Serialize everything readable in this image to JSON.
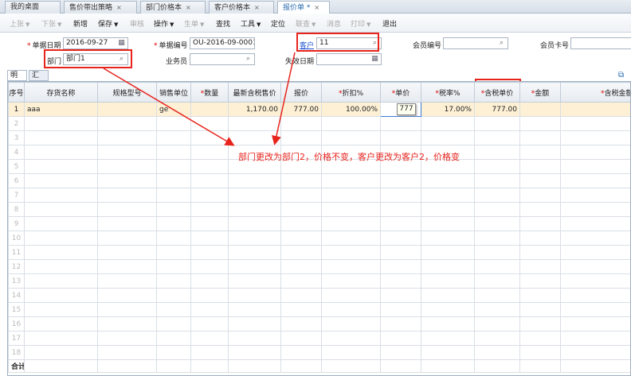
{
  "tabs": [
    {
      "label": "我的桌面",
      "closable": false
    },
    {
      "label": "售价带出策略",
      "closable": true
    },
    {
      "label": "部门价格本",
      "closable": true
    },
    {
      "label": "客户价格本",
      "closable": true
    },
    {
      "label": "报价单 *",
      "closable": true,
      "active": true
    }
  ],
  "close_glyph": "×",
  "toolbar": {
    "prev": "上张",
    "next": "下张",
    "add": "新增",
    "save": "保存",
    "audit": "审核",
    "operate": "操作",
    "generate": "生单",
    "find": "查找",
    "tools": "工具",
    "locate": "定位",
    "join": "联查",
    "message": "消息",
    "print": "打印",
    "exit": "退出"
  },
  "form": {
    "date_label": "单据日期",
    "date_value": "2016-09-27",
    "code_label": "单据编号",
    "code_value": "OU-2016-09-0001",
    "customer_label": "客户",
    "customer_value": "11",
    "member_code_label": "会员编号",
    "member_code_value": "",
    "member_card_label": "会员卡号",
    "member_card_value": "",
    "dept_label": "部门",
    "dept_value": "部门1",
    "salesman_label": "业务员",
    "salesman_value": "",
    "expiry_label": "失效日期",
    "expiry_value": ""
  },
  "subtabs": [
    "明细",
    "汇总"
  ],
  "grid": {
    "headers": [
      "序号",
      "存货名称",
      "规格型号",
      "销售单位",
      "数量",
      "最新含税售价",
      "报价",
      "折扣%",
      "单价",
      "税率%",
      "含税单价",
      "金额",
      "含税金额"
    ],
    "required": [
      false,
      false,
      false,
      false,
      true,
      false,
      false,
      true,
      true,
      true,
      true,
      true,
      true
    ],
    "row1": {
      "seq": "1",
      "name": "aaa",
      "spec": "",
      "unit": "ge",
      "qty": "",
      "latest_price": "1,170.00",
      "quote": "777.00",
      "discount": "100.00%",
      "unit_price": "",
      "tax_rate": "17.00%",
      "tax_unit_price": "777.00",
      "amount": "",
      "tax_amount": ""
    },
    "empty_rows": [
      "2",
      "3",
      "4",
      "5",
      "6",
      "7",
      "8",
      "9",
      "10",
      "11",
      "12",
      "13",
      "14",
      "15",
      "16",
      "17",
      "18"
    ],
    "total_label": "合计"
  },
  "tooltip": "777",
  "annotation": "部门更改为部门2，价格不变，客户更改为客户2，价格变",
  "colors": {
    "accent": "#2b6cb0",
    "highlight_row": "#fdf0d5",
    "annotation_red": "#e8231c"
  },
  "icons": [
    "calendar-icon",
    "search-icon",
    "refresh-icon",
    "close-icon",
    "caret-down-icon"
  ]
}
